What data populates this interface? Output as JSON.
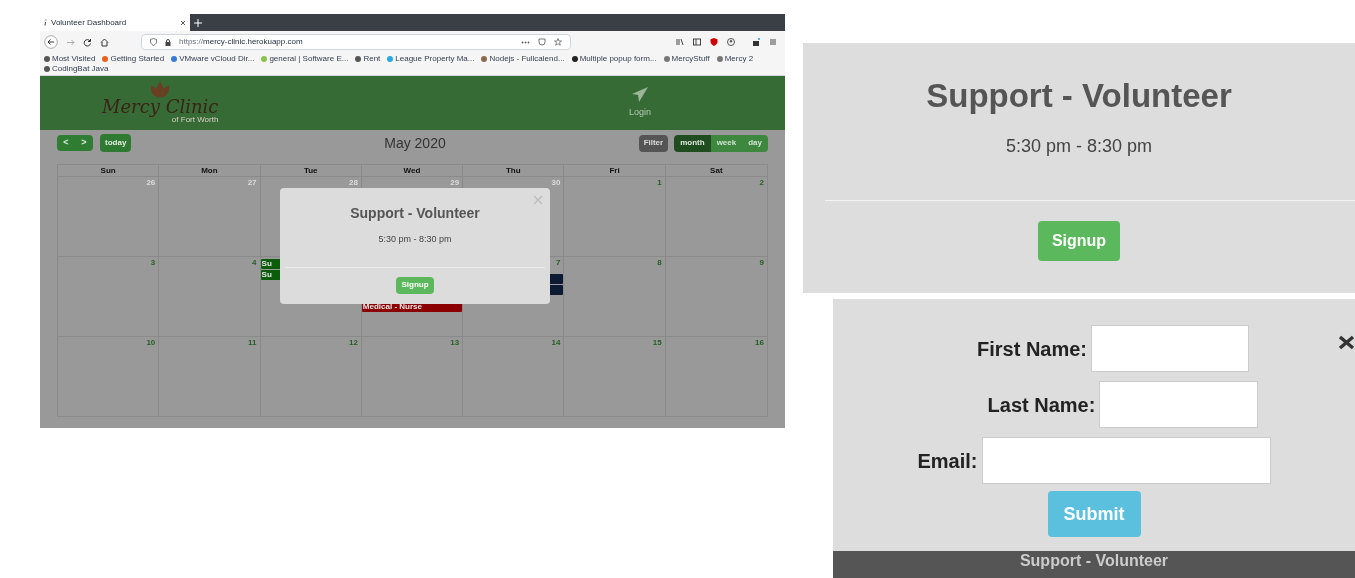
{
  "browser": {
    "tab_title": "Volunteer Dashboard",
    "url_prefix": "https://",
    "url_host": "mercy-clinic.herokuapp.com",
    "bookmarks": [
      {
        "label": "Most Visited"
      },
      {
        "label": "Getting Started"
      },
      {
        "label": "VMware vCloud Dir..."
      },
      {
        "label": "general | Software E..."
      },
      {
        "label": "Rent"
      },
      {
        "label": "League Property Ma..."
      },
      {
        "label": "Nodejs - Fullcalend..."
      },
      {
        "label": "Multiple popup form..."
      },
      {
        "label": "MercyStuff"
      },
      {
        "label": "Mercy 2"
      },
      {
        "label": "CodingBat Java"
      }
    ]
  },
  "header": {
    "logo_title": "Mercy Clinic",
    "logo_subtitle": "of Fort Worth",
    "login": "Login"
  },
  "calendar": {
    "prev": "<",
    "next": ">",
    "today": "today",
    "title": "May 2020",
    "filter": "Filter",
    "views": [
      {
        "label": "month",
        "selected": true
      },
      {
        "label": "week",
        "selected": false
      },
      {
        "label": "day",
        "selected": false
      }
    ],
    "weekdays": [
      "Sun",
      "Mon",
      "Tue",
      "Wed",
      "Thu",
      "Fri",
      "Sat"
    ],
    "weeks": [
      [
        {
          "day": "26",
          "muted": true
        },
        {
          "day": "27",
          "muted": true
        },
        {
          "day": "28",
          "muted": true
        },
        {
          "day": "29",
          "muted": true
        },
        {
          "day": "30",
          "muted": true
        },
        {
          "day": "1",
          "muted": false
        },
        {
          "day": "2",
          "muted": false
        }
      ],
      [
        {
          "day": "3",
          "muted": false
        },
        {
          "day": "4",
          "muted": false
        },
        {
          "events": [
            {
              "label": "Su",
              "color": "#0b5d0b"
            },
            {
              "label": "Su",
              "color": "#0b5d0b"
            }
          ]
        },
        {
          "events": [
            {
              "label": "Medical - Nurse",
              "color": "#8b0000"
            }
          ]
        },
        {
          "day": "7",
          "muted": false,
          "events": [
            {
              "color": "#0d1a33"
            },
            {
              "color": "#0d1a33"
            }
          ]
        },
        {
          "day": "8",
          "muted": false
        },
        {
          "day": "9",
          "muted": false
        }
      ],
      [
        {
          "day": "10",
          "muted": false
        },
        {
          "day": "11",
          "muted": false
        },
        {
          "day": "12",
          "muted": false
        },
        {
          "day": "13",
          "muted": false
        },
        {
          "day": "14",
          "muted": false
        },
        {
          "day": "15",
          "muted": false
        },
        {
          "day": "16",
          "muted": false
        }
      ]
    ]
  },
  "modal": {
    "title": "Support - Volunteer",
    "time": "5:30 pm - 8:30 pm",
    "button": "Signup"
  },
  "zoom_modal": {
    "title": "Support - Volunteer",
    "time": "5:30 pm - 8:30 pm",
    "button": "Signup"
  },
  "signup_form": {
    "fields": [
      {
        "label": "First Name:"
      },
      {
        "label": "Last Name:"
      },
      {
        "label": "Email:"
      }
    ],
    "submit": "Submit",
    "below_title": "Support - Volunteer"
  }
}
